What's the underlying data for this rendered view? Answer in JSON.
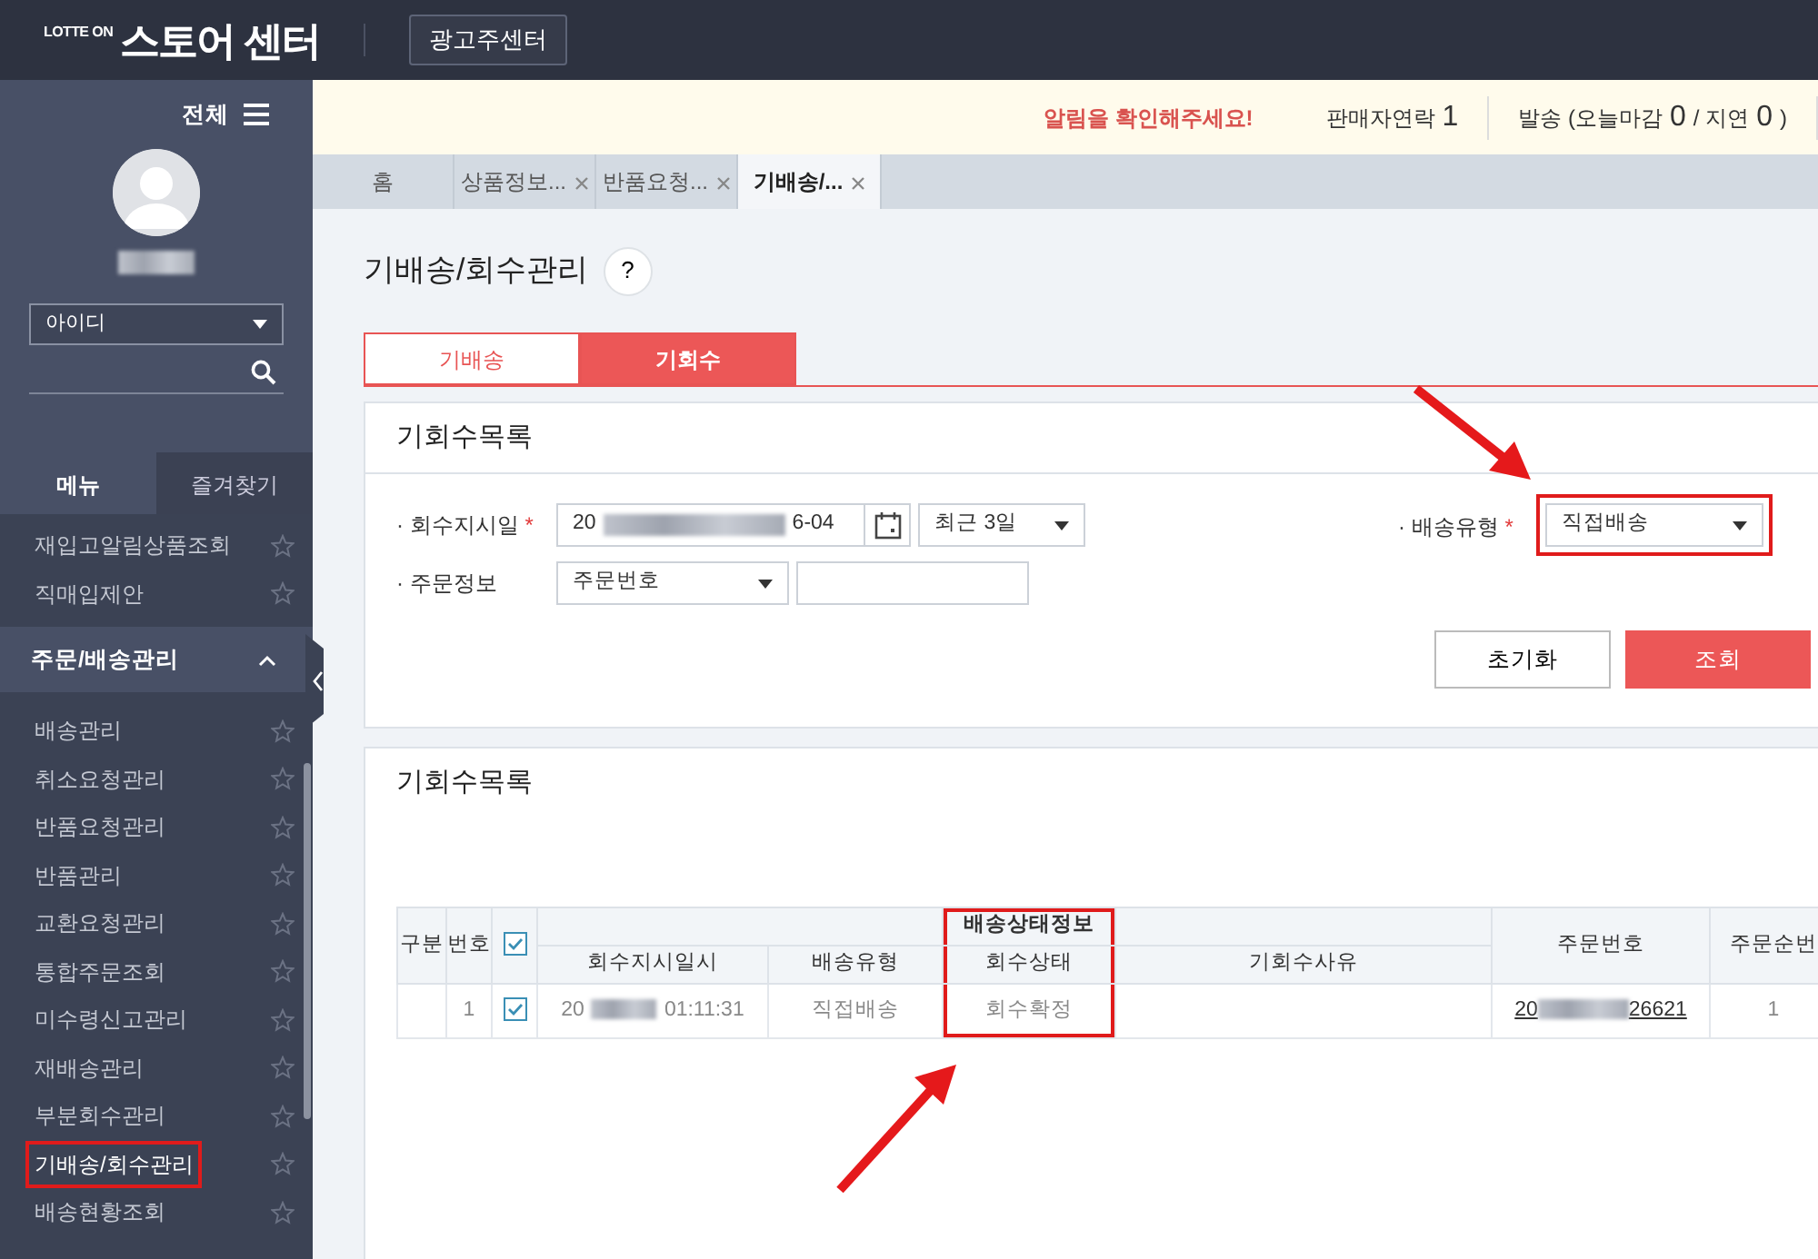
{
  "header": {
    "logo_small": "LOTTE ON",
    "logo_title": "스토어 센터",
    "ad_button": "광고주센터"
  },
  "notice_bar": {
    "alert": "알림을 확인해주세요!",
    "items": [
      {
        "kind": "counter",
        "label": "판매자연락",
        "count": "1"
      },
      {
        "kind": "delivery",
        "label": "발송 (오늘마감",
        "count": "0",
        "label2": "/ 지연",
        "count2": "0",
        "close": ")"
      }
    ]
  },
  "sidebar": {
    "all_label": "전체",
    "id_select": "아이디",
    "tabs": [
      {
        "label": "메뉴",
        "selected": true
      },
      {
        "label": "즐겨찾기",
        "selected": false
      }
    ],
    "items_top": [
      {
        "label": "재입고알림상품조회",
        "highlighted": false
      },
      {
        "label": "직매입제안",
        "highlighted": false
      }
    ],
    "section": {
      "label": "주문/배송관리",
      "expanded": true
    },
    "items": [
      {
        "label": "배송관리",
        "highlighted": false
      },
      {
        "label": "취소요청관리",
        "highlighted": false
      },
      {
        "label": "반품요청관리",
        "highlighted": false
      },
      {
        "label": "반품관리",
        "highlighted": false
      },
      {
        "label": "교환요청관리",
        "highlighted": false
      },
      {
        "label": "통합주문조회",
        "highlighted": false
      },
      {
        "label": "미수령신고관리",
        "highlighted": false
      },
      {
        "label": "재배송관리",
        "highlighted": false
      },
      {
        "label": "부분회수관리",
        "highlighted": false
      },
      {
        "label": "기배송/회수관리",
        "highlighted": true
      },
      {
        "label": "배송현황조회",
        "highlighted": false
      }
    ]
  },
  "page_tabs": [
    {
      "label": "홈",
      "closable": false,
      "selected": false
    },
    {
      "label": "상품정보...",
      "closable": true,
      "selected": false
    },
    {
      "label": "반품요청...",
      "closable": true,
      "selected": false
    },
    {
      "label": "기배송/...",
      "closable": true,
      "selected": true
    }
  ],
  "page": {
    "title": "기배송/회수관리",
    "help": "?"
  },
  "sub_tabs": [
    {
      "label": "기배송",
      "selected": false
    },
    {
      "label": "기회수",
      "selected": true
    }
  ],
  "filter": {
    "title": "기회수목록",
    "date_label": "· 회수지시일",
    "date_required_mark": "*",
    "date_prefix": "20",
    "date_suffix": "6-04",
    "period": "최근 3일",
    "type_label": "· 배송유형",
    "type_required_mark": "*",
    "type_value": "직접배송",
    "type_highlighted": true,
    "order_label": "· 주문정보",
    "order_select": "주문번호",
    "reset_button": "초기화",
    "search_button": "조회"
  },
  "results": {
    "title": "기회수목록",
    "columns": [
      "구분",
      "번호",
      "회수지시일시",
      "배송유형",
      "회수상태",
      "기회수사유",
      "주문번호",
      "주문순번"
    ],
    "group_header": "배송상태정보",
    "group_highlighted": true,
    "header_checked": true,
    "rows": [
      {
        "number": "1",
        "checked": true,
        "datetime_prefix": "20",
        "datetime_suffix": "01:11:31",
        "type": "직접배송",
        "status": "회수확정",
        "order_prefix": "20",
        "order_suffix": "26621",
        "order_seq": "1"
      }
    ]
  }
}
